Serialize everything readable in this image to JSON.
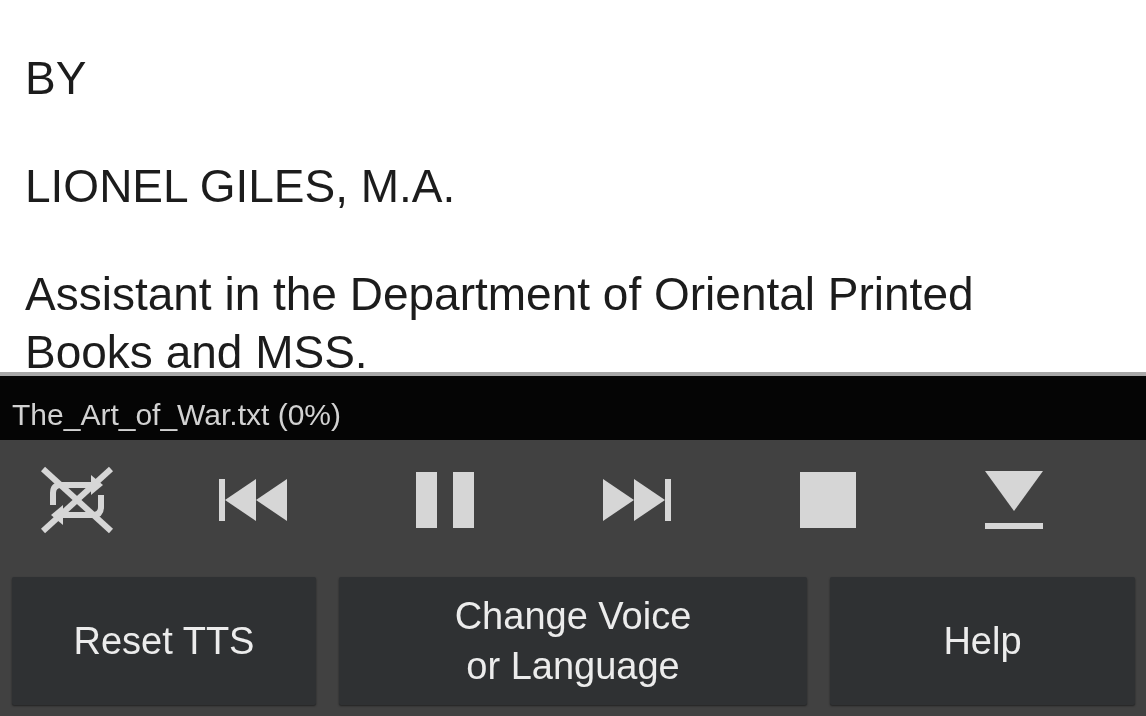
{
  "document": {
    "paragraphs": [
      "BY",
      "LIONEL GILES, M.A.",
      "Assistant in the Department of Oriental Printed Books and MSS."
    ]
  },
  "player": {
    "file_status": "The_Art_of_War.txt (0%)",
    "buttons": [
      "Reset TTS",
      "Change Voice or Language",
      "Help"
    ]
  }
}
